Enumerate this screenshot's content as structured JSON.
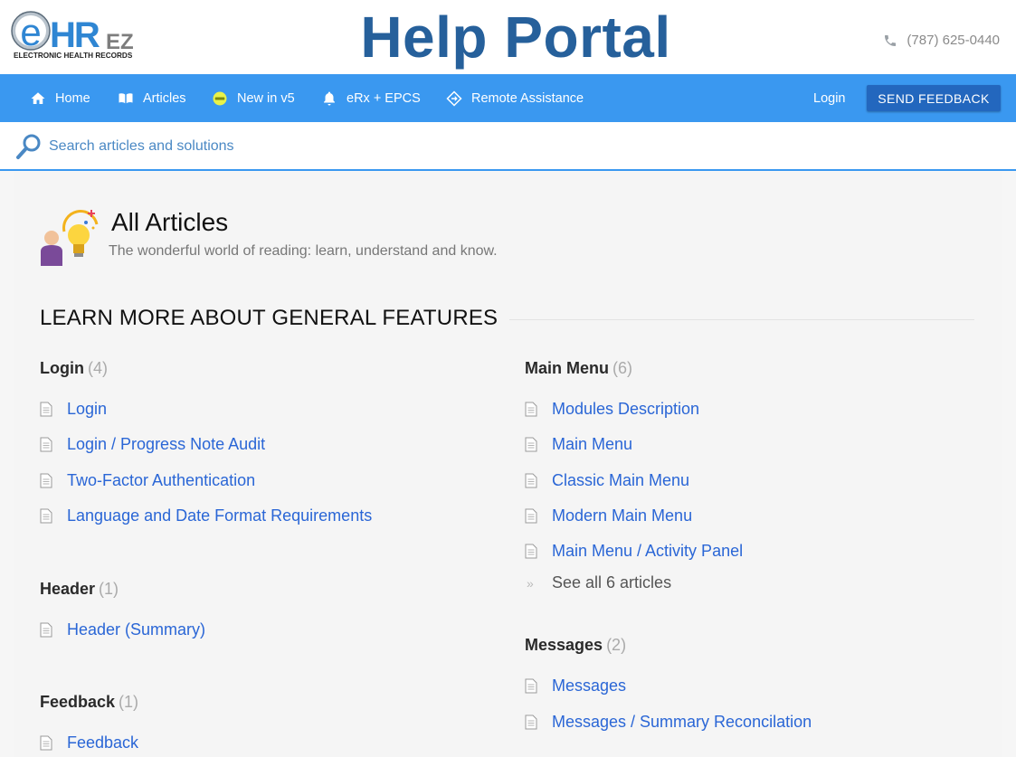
{
  "brand": {
    "logo_e": "e",
    "logo_hr": "HR",
    "logo_ez": "EZ",
    "logo_tagline": "ELECTRONIC HEALTH RECORDS",
    "portal_title": "Help Portal",
    "phone": "(787) 625-0440"
  },
  "nav": {
    "items": [
      {
        "label": "Home",
        "icon": "home-icon"
      },
      {
        "label": "Articles",
        "icon": "book-icon"
      },
      {
        "label": "New in v5",
        "icon": "new-badge-icon"
      },
      {
        "label": "eRx + EPCS",
        "icon": "bell-icon"
      },
      {
        "label": "Remote Assistance",
        "icon": "diamond-arrow-icon"
      }
    ],
    "login": "Login",
    "feedback": "SEND FEEDBACK"
  },
  "search": {
    "placeholder": "Search articles and solutions",
    "value": ""
  },
  "page": {
    "title": "All Articles",
    "subtitle": "The wonderful world of reading: learn, understand and know."
  },
  "section": {
    "heading": "LEARN MORE ABOUT GENERAL FEATURES",
    "left": [
      {
        "title": "Login",
        "count": "(4)",
        "articles": [
          "Login",
          "Login / Progress Note Audit",
          "Two-Factor Authentication",
          "Language and Date Format Requirements"
        ]
      },
      {
        "title": "Header",
        "count": "(1)",
        "articles": [
          "Header (Summary)"
        ]
      },
      {
        "title": "Feedback",
        "count": "(1)",
        "articles": [
          "Feedback"
        ]
      }
    ],
    "right": [
      {
        "title": "Main Menu",
        "count": "(6)",
        "articles": [
          "Modules Description",
          "Main Menu",
          "Classic Main Menu",
          "Modern Main Menu",
          "Main Menu / Activity Panel"
        ],
        "see_all": "See all 6 articles"
      },
      {
        "title": "Messages",
        "count": "(2)",
        "articles": [
          "Messages",
          "Messages / Summary Reconcilation"
        ]
      }
    ]
  },
  "colors": {
    "nav_bg": "#3a98f0",
    "title_blue": "#26609b",
    "link_blue": "#2a66d6",
    "button_bg": "#2367be"
  }
}
